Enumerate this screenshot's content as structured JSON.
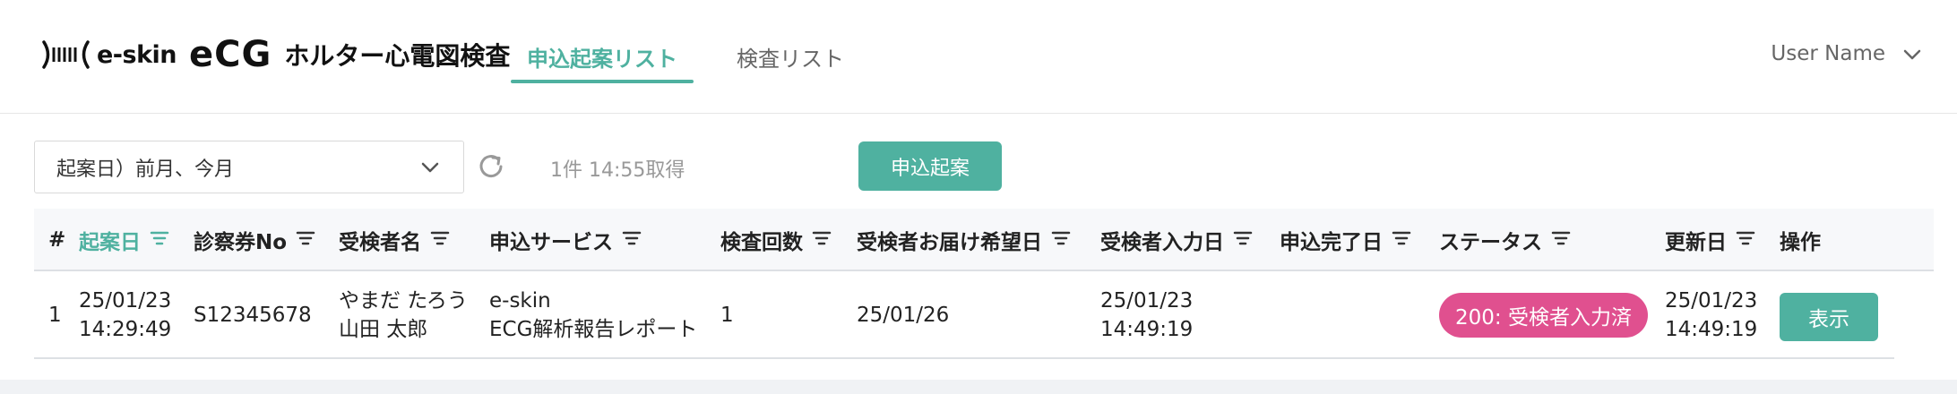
{
  "header": {
    "logo_brand": "e-skin",
    "logo_ecg": "eCG",
    "logo_title": "ホルター心電図検査",
    "tabs": [
      {
        "label": "申込起案リスト",
        "active": true
      },
      {
        "label": "検査リスト",
        "active": false
      }
    ],
    "user_name": "User Name"
  },
  "toolbar": {
    "filter_value": "起案日）前月、今月",
    "fetch_status": "1件 14:55取得",
    "create_button": "申込起案"
  },
  "table": {
    "columns": [
      "#",
      "起案日",
      "診察券No",
      "受検者名",
      "申込サービス",
      "検査回数",
      "受検者お届け希望日",
      "受検者入力日",
      "申込完了日",
      "ステータス",
      "更新日",
      "操作"
    ],
    "sorted_column": "起案日",
    "rows": [
      {
        "index": "1",
        "draft_date": "25/01/23",
        "draft_time": "14:29:49",
        "patient_no": "S12345678",
        "name_kana": "やまだ たろう",
        "name_kanji": "山田 太郎",
        "service_line1": "e-skin",
        "service_line2": "ECG解析報告レポート",
        "exam_count": "1",
        "desired_date": "25/01/26",
        "input_date": "25/01/23",
        "input_time": "14:49:19",
        "complete_date": "",
        "status": "200: 受検者入力済",
        "updated_date": "25/01/23",
        "updated_time": "14:49:19",
        "action": "表示"
      }
    ]
  },
  "colors": {
    "accent": "#4fb1a0",
    "status_badge": "#e0508f"
  },
  "icons": [
    "ecg-wave-icon",
    "chevron-down-icon",
    "refresh-icon",
    "filter-icon"
  ]
}
